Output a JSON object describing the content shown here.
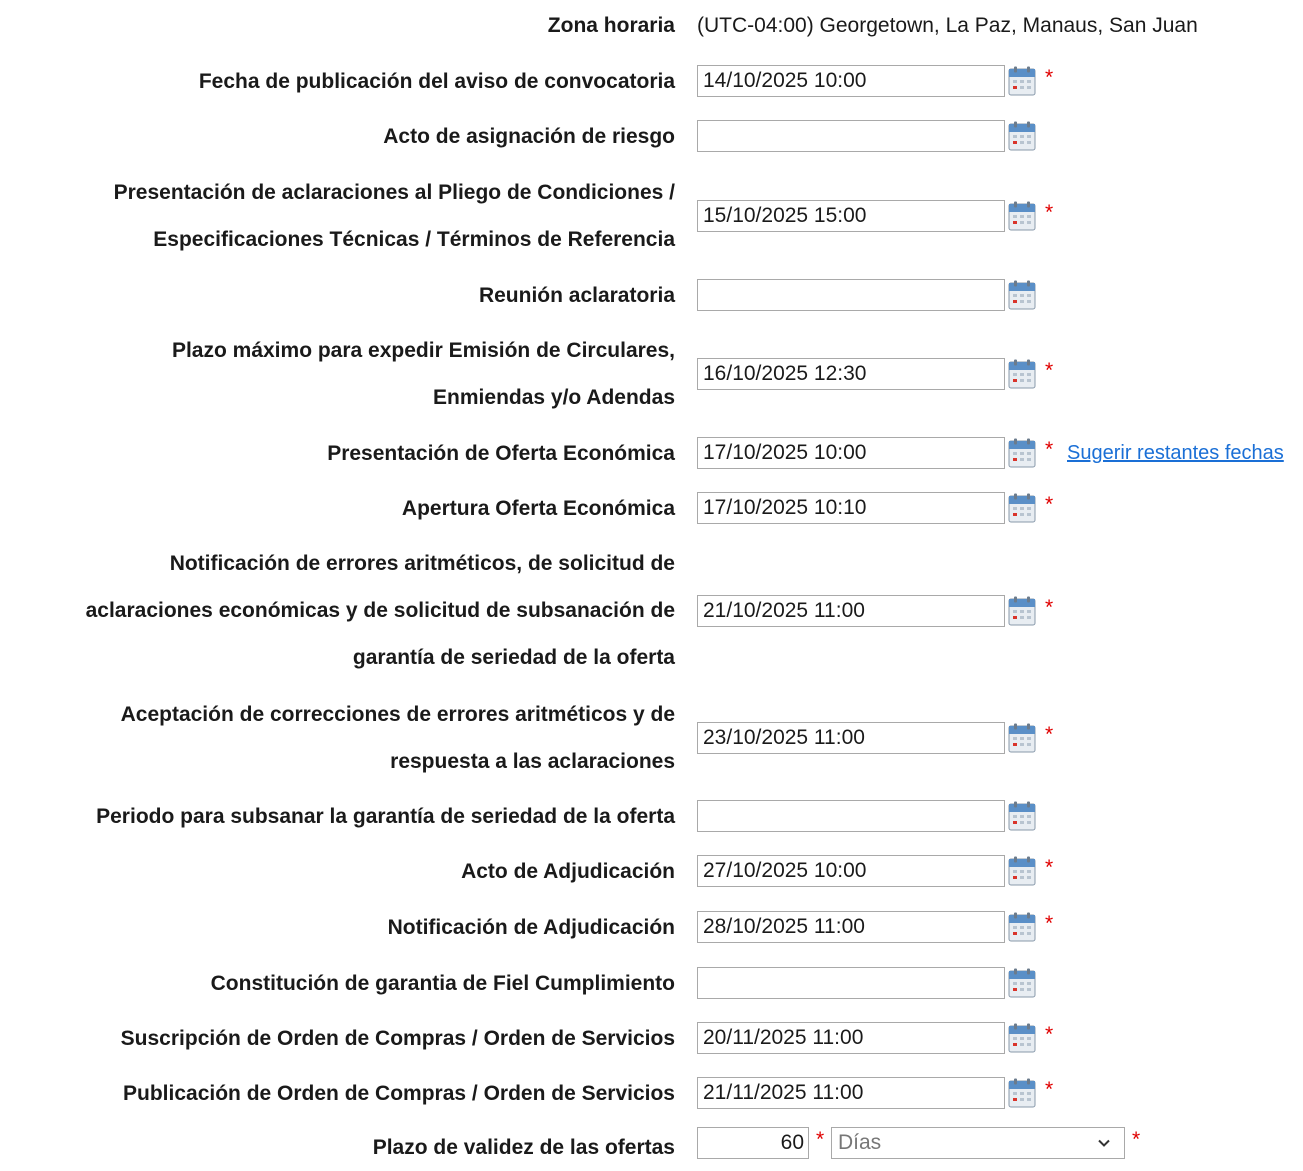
{
  "timezone": {
    "label": "Zona horaria",
    "value": "(UTC-04:00) Georgetown, La Paz, Manaus, San Juan"
  },
  "required_marker": "*",
  "suggest_link": "Sugerir restantes fechas",
  "fields": [
    {
      "lines": [
        "Fecha de publicación del aviso de convocatoria"
      ],
      "value": "14/10/2025 10:00",
      "required": true
    },
    {
      "lines": [
        "Acto de asignación de riesgo"
      ],
      "value": "",
      "required": false
    },
    {
      "lines": [
        "Presentación de aclaraciones al Pliego de Condiciones /",
        "Especificaciones Técnicas / Términos de Referencia"
      ],
      "value": "15/10/2025 15:00",
      "required": true
    },
    {
      "lines": [
        "Reunión aclaratoria"
      ],
      "value": "",
      "required": false
    },
    {
      "lines": [
        "Plazo máximo para expedir Emisión de Circulares,",
        "Enmiendas y/o Adendas"
      ],
      "value": "16/10/2025 12:30",
      "required": true
    },
    {
      "lines": [
        "Presentación de Oferta Económica"
      ],
      "value": "17/10/2025 10:00",
      "required": true
    },
    {
      "lines": [
        "Apertura Oferta Económica"
      ],
      "value": "17/10/2025 10:10",
      "required": true
    },
    {
      "lines": [
        "Notificación de errores aritméticos, de solicitud de",
        "aclaraciones económicas y de solicitud de subsanación de",
        "garantía de seriedad de la oferta"
      ],
      "value": "21/10/2025 11:00",
      "required": true
    },
    {
      "lines": [
        "Aceptación de correcciones de errores aritméticos y de",
        "respuesta a las aclaraciones"
      ],
      "value": "23/10/2025 11:00",
      "required": true
    },
    {
      "lines": [
        "Periodo para subsanar la garantía de seriedad de la oferta"
      ],
      "value": "",
      "required": false
    },
    {
      "lines": [
        "Acto de Adjudicación"
      ],
      "value": "27/10/2025 10:00",
      "required": true
    },
    {
      "lines": [
        "Notificación de Adjudicación"
      ],
      "value": "28/10/2025 11:00",
      "required": true
    },
    {
      "lines": [
        "Constitución de garantia de Fiel Cumplimiento"
      ],
      "value": "",
      "required": false
    },
    {
      "lines": [
        "Suscripción de Orden de Compras / Orden de Servicios"
      ],
      "value": "20/11/2025 11:00",
      "required": true
    },
    {
      "lines": [
        "Publicación de Orden de Compras / Orden de Servicios"
      ],
      "value": "21/11/2025 11:00",
      "required": true
    }
  ],
  "validity": {
    "label": "Plazo de validez de las ofertas",
    "value": "60",
    "unit_selected": "Días"
  },
  "icons": {
    "calendar": "calendar-icon",
    "dropdown": "chevron-down-icon"
  }
}
